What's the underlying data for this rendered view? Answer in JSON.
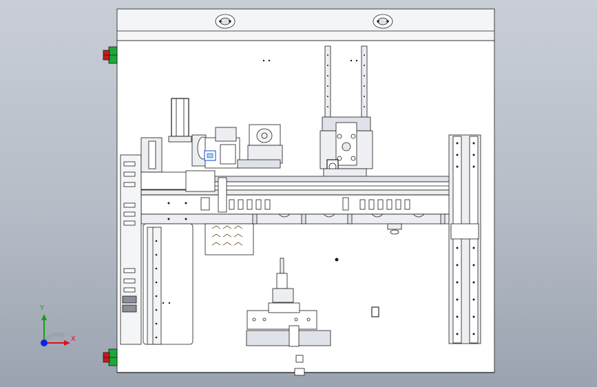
{
  "viewport": {
    "background_top": "#c9ced6",
    "background_bottom": "#9aa3b0"
  },
  "triad": {
    "x_label": "X",
    "y_label": "Y",
    "x_color": "#e0101a",
    "y_color": "#14a014",
    "z_color": "#1020e0"
  },
  "colors": {
    "frame_fill": "#ffffff",
    "line": "#1a1a1a",
    "panel_fill": "#eceef2",
    "rail_fill": "#d8dbe2",
    "highlight_blue": "#3a62d8",
    "button_green": "#1fa83a",
    "button_red": "#c41c1c"
  },
  "icons": {
    "emergency_button": "mushroom-button-icon",
    "triad": "coordinate-triad-icon"
  }
}
